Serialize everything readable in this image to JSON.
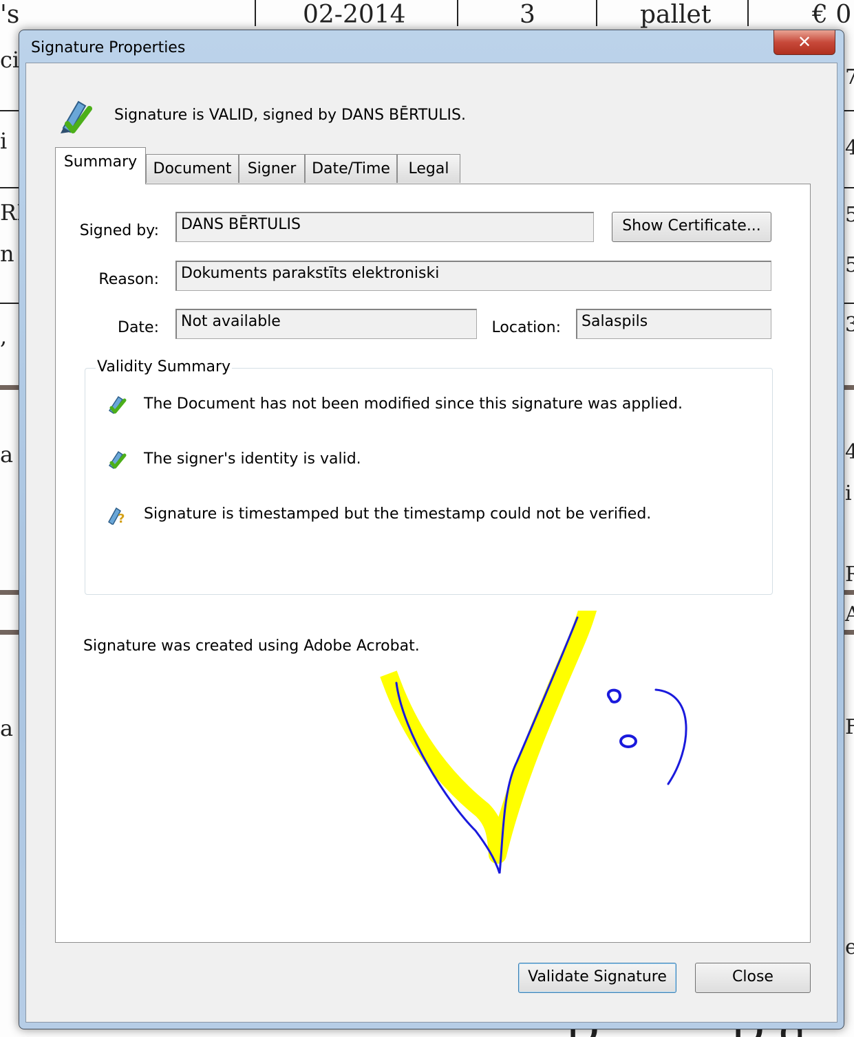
{
  "background_document": {
    "top_cells": [
      "'s",
      "02-2014",
      "3",
      "pallet",
      "€ 0"
    ],
    "left_fragments": [
      "ci",
      "i",
      "RI",
      "n",
      ",",
      "a",
      "a"
    ],
    "right_fragments": [
      "7",
      "4",
      "5",
      "5",
      "3",
      "4",
      "i",
      "R",
      "A",
      "F",
      "e"
    ],
    "bottom_fragments": [
      "D",
      "D d"
    ]
  },
  "window": {
    "title": "Signature Properties",
    "close_glyph": "✕"
  },
  "status": {
    "icon": "valid-signature-pen-icon",
    "text": "Signature is VALID, signed by DANS BĒRTULIS."
  },
  "tabs": [
    {
      "label": "Summary",
      "active": true
    },
    {
      "label": "Document",
      "active": false
    },
    {
      "label": "Signer",
      "active": false
    },
    {
      "label": "Date/Time",
      "active": false
    },
    {
      "label": "Legal",
      "active": false
    }
  ],
  "summary": {
    "signed_by_label": "Signed by:",
    "signed_by_value": "DANS BĒRTULIS",
    "show_certificate_label": "Show Certificate...",
    "reason_label": "Reason:",
    "reason_value": "Dokuments parakstīts elektroniski",
    "date_label": "Date:",
    "date_value": "Not available",
    "location_label": "Location:",
    "location_value": "Salaspils"
  },
  "validity": {
    "title": "Validity Summary",
    "items": [
      {
        "icon": "valid-pen-icon",
        "text": "The Document has not been modified since this signature was applied."
      },
      {
        "icon": "valid-pen-icon",
        "text": "The signer's identity is valid."
      },
      {
        "icon": "unknown-pen-icon",
        "text": "Signature is timestamped but the timestamp could not be verified."
      }
    ]
  },
  "creator_text": "Signature was created using Adobe Acrobat.",
  "signature_image": {
    "icon": "handwritten-checkmark-signature",
    "highlight_color": "#ffff00",
    "ink_color": "#1a1adc"
  },
  "buttons": {
    "validate_label": "Validate Signature",
    "close_label": "Close"
  },
  "colors": {
    "valid_green": "#4caf1a",
    "window_frame": "#a9c4e1",
    "close_red": "#c7493a"
  }
}
